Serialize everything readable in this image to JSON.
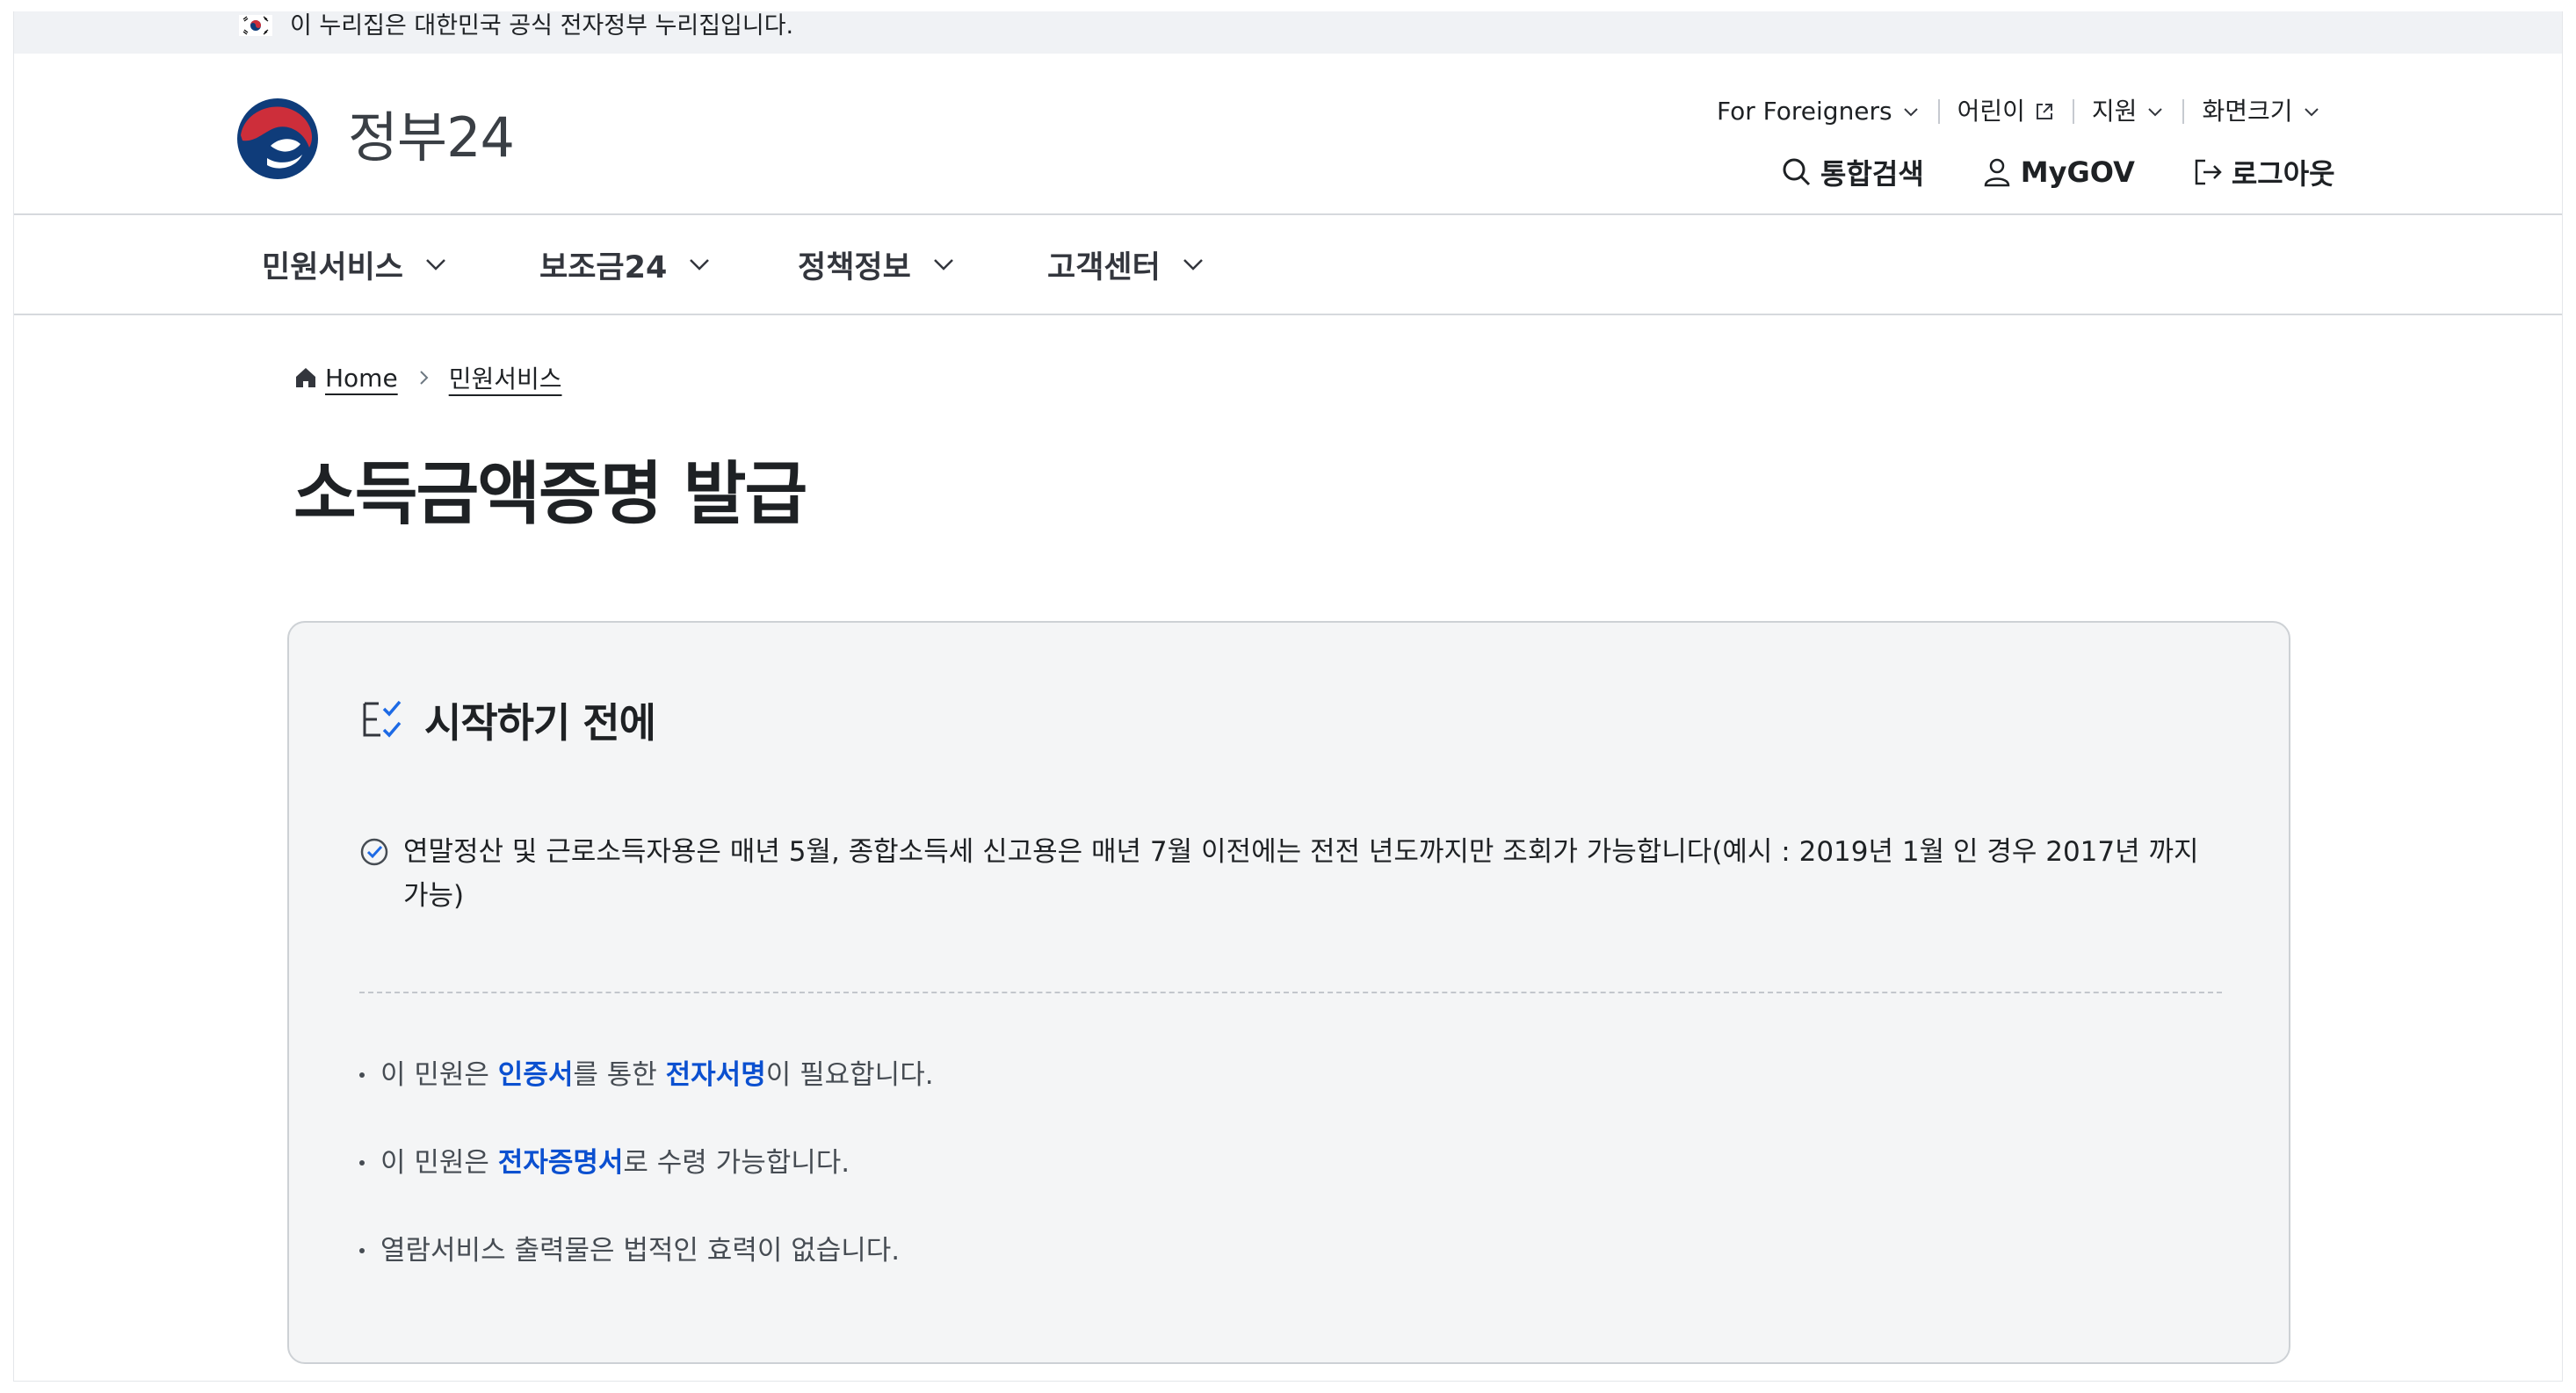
{
  "gov_banner": {
    "text": "이 누리집은 대한민국 공식 전자정부 누리집입니다."
  },
  "logo": {
    "text": "정부24"
  },
  "util_nav": {
    "foreigners": "For Foreigners",
    "kids": "어린이",
    "support": "지원",
    "screen_size": "화면크기"
  },
  "main_util": {
    "search": "통합검색",
    "mygov": "MyGOV",
    "logout": "로그아웃"
  },
  "gnb": {
    "items": [
      "민원서비스",
      "보조금24",
      "정책정보",
      "고객센터"
    ]
  },
  "breadcrumb": {
    "home": "Home",
    "current": "민원서비스"
  },
  "page": {
    "title": "소득금액증명 발급"
  },
  "info_box": {
    "title": "시작하기 전에",
    "check_text": "연말정산 및 근로소득자용은 매년 5월, 종합소득세 신고용은 매년 7월 이전에는 전전 년도까지만 조회가 가능합니다(예시 : 2019년 1월 인 경우 2017년 까지 가능)",
    "bullets": {
      "b1_pre": "이 민원은 ",
      "b1_hl1": "인증서",
      "b1_mid": "를 통한 ",
      "b1_hl2": "전자서명",
      "b1_post": "이 필요합니다.",
      "b2_pre": "이 민원은 ",
      "b2_hl": "전자증명서",
      "b2_post": "로 수령 가능합니다.",
      "b3": "열람서비스 출력물은 법적인 효력이 없습니다."
    }
  },
  "colors": {
    "accent_blue": "#0b50d0",
    "logo_red": "#cd2e3a",
    "logo_blue": "#0f3c7a",
    "box_bg": "#f4f5f6"
  }
}
